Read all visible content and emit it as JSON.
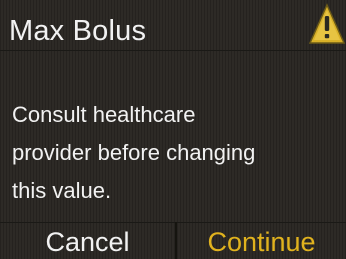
{
  "screen": {
    "title": "Max Bolus",
    "warning_icon": "warning-triangle-icon",
    "message_lines": [
      "Consult healthcare",
      "provider before changing",
      "this value."
    ]
  },
  "softkeys": {
    "left_label": "Cancel",
    "right_label": "Continue"
  },
  "colors": {
    "background": "#2d2a26",
    "text": "#f2f2f2",
    "accent": "#e0b21e"
  }
}
